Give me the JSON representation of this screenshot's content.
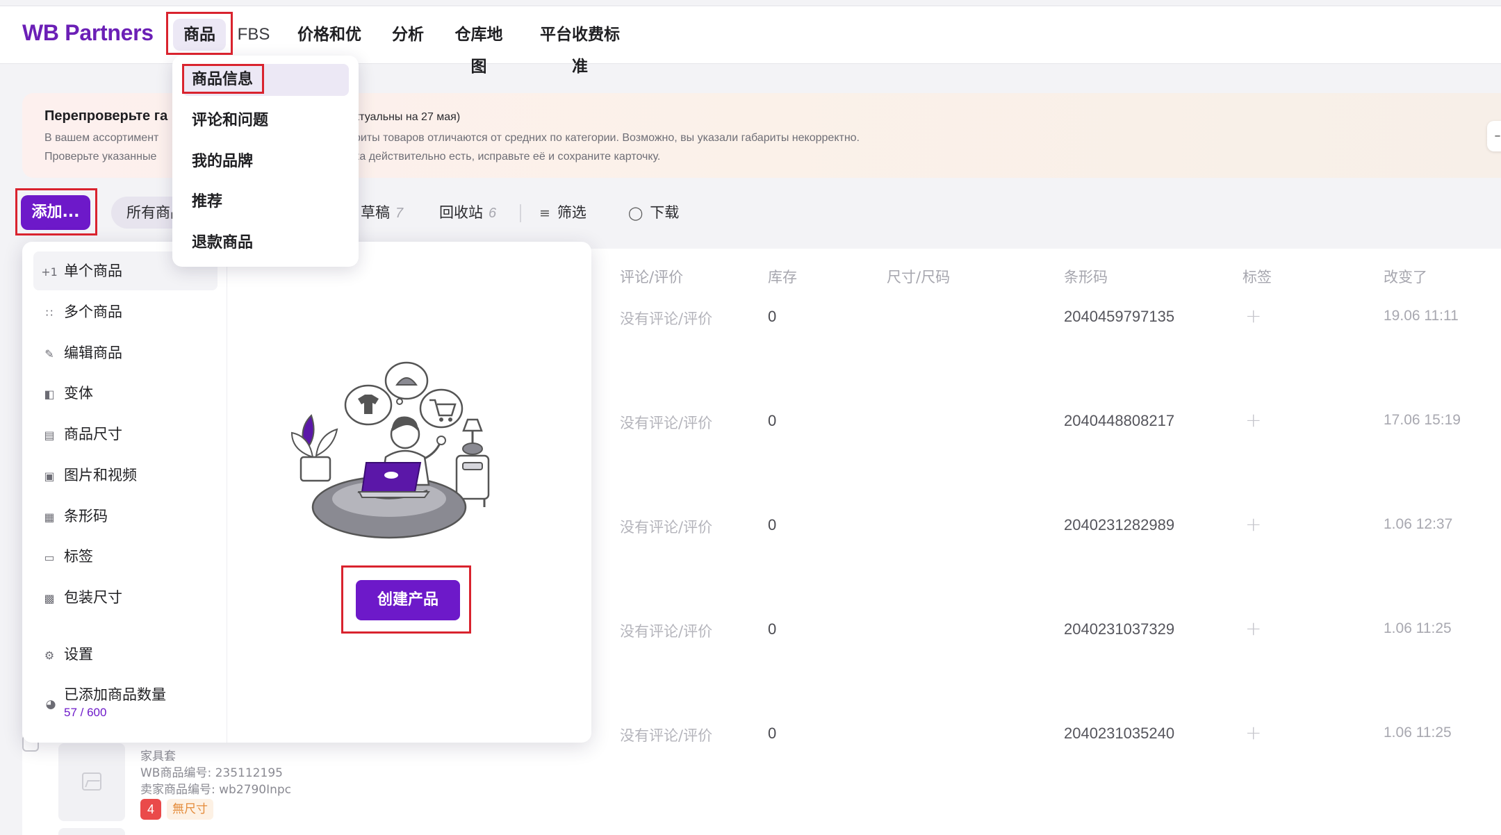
{
  "app": {
    "logo": "WB Partners"
  },
  "nav": {
    "items": [
      "商品",
      "FBS",
      "价格和优惠",
      "分析",
      "仓库地图",
      "平台收费标准"
    ],
    "active": "商品"
  },
  "goods_menu": {
    "items": [
      "商品信息",
      "评论和问题",
      "我的品牌",
      "推荐",
      "退款商品"
    ],
    "active": "商品信息"
  },
  "notice": {
    "title": "Перепроверьте га",
    "date_note": "ктуальны на 27 мая)",
    "line1_left": "В вашем ассортимент",
    "line1_right": "риты товаров отличаются от средних по категории. Возможно, вы указали габариты некорректно.",
    "line2_left": "Проверьте указанные",
    "line2_right": "ка действительно есть, исправьте её и сохраните карточку.",
    "close_label": "–"
  },
  "toolbar": {
    "add_label": "添加...",
    "all_label": "所有商品",
    "drafts_label": "草稿",
    "drafts_count": "7",
    "trash_label": "回收站",
    "trash_count": "6",
    "filter_label": "筛选",
    "download_label": "下载"
  },
  "add_menu": {
    "items": [
      {
        "label": "单个商品",
        "icon": "plus-one-icon"
      },
      {
        "label": "多个商品",
        "icon": "grid-dots-icon"
      },
      {
        "label": "编辑商品",
        "icon": "pencil-icon"
      },
      {
        "label": "变体",
        "icon": "variant-icon"
      },
      {
        "label": "商品尺寸",
        "icon": "ruler-icon"
      },
      {
        "label": "图片和视频",
        "icon": "image-icon"
      },
      {
        "label": "条形码",
        "icon": "barcode-icon"
      },
      {
        "label": "标签",
        "icon": "tag-icon"
      },
      {
        "label": "包装尺寸",
        "icon": "package-ruler-icon"
      }
    ],
    "settings_label": "设置",
    "quota_label": "已添加商品数量",
    "quota_value": "57 / 600",
    "create_label": "创建产品"
  },
  "table": {
    "headers": [
      "评论/评价",
      "库存",
      "尺寸/尺码",
      "条形码",
      "标签",
      "改变了"
    ],
    "rows": [
      {
        "review": "没有评论/评价",
        "stock": "0",
        "barcode": "2040459797135",
        "tag": "+",
        "changed": "19.06 11:11"
      },
      {
        "review": "没有评论/评价",
        "stock": "0",
        "barcode": "2040448808217",
        "tag": "+",
        "changed": "17.06 15:19"
      },
      {
        "review": "没有评论/评价",
        "stock": "0",
        "barcode": "2040231282989",
        "tag": "+",
        "changed": "1.06 12:37"
      },
      {
        "review": "没有评论/评价",
        "stock": "0",
        "barcode": "2040231037329",
        "tag": "+",
        "changed": "1.06 11:25"
      },
      {
        "review": "没有评论/评价",
        "stock": "0",
        "barcode": "2040231035240",
        "tag": "+",
        "changed": "1.06 11:25"
      }
    ],
    "product": {
      "name": "家具套",
      "wb_id": "WB商品编号: 235112195",
      "seller_id": "卖家商品编号: wb2790Inpc",
      "badge_count": "4",
      "badge_text": "無尺寸"
    }
  },
  "colors": {
    "accent": "#6d19c9",
    "highlight": "#d9232e",
    "logo": "#6b1fb6"
  }
}
